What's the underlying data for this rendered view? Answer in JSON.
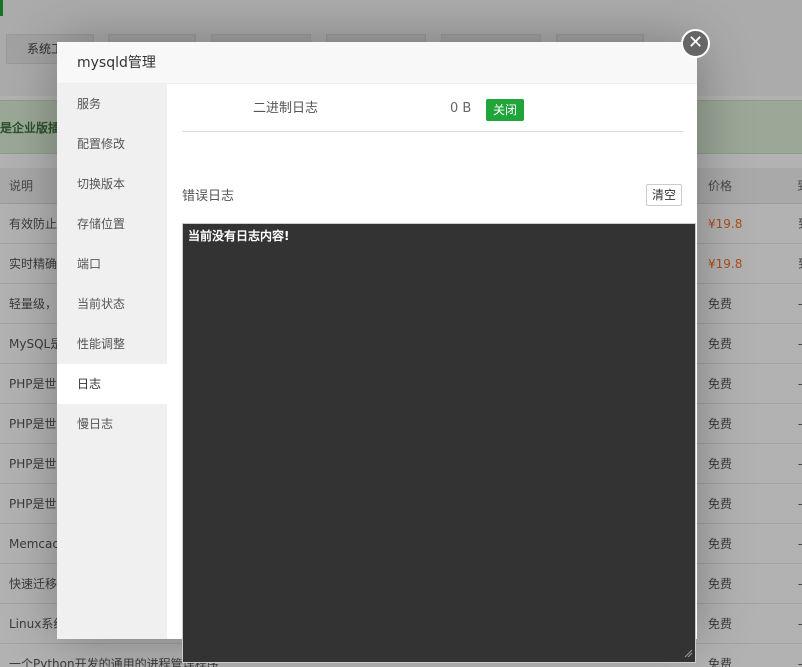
{
  "background": {
    "tabs": [
      "系统工具",
      "",
      "",
      "",
      "",
      ""
    ],
    "banner_text": "是企业版插件",
    "table": {
      "headers": {
        "description": "说明",
        "price": "价格",
        "tail": "到"
      },
      "rows": [
        {
          "description": "有效防止",
          "price": "¥19.8",
          "paid": true,
          "tail": "到"
        },
        {
          "description": "实时精确",
          "price": "¥19.8",
          "paid": true,
          "tail": "到"
        },
        {
          "description": "轻量级，",
          "price": "免费",
          "paid": false,
          "tail": "-"
        },
        {
          "description": "MySQL是",
          "price": "免费",
          "paid": false,
          "tail": "-"
        },
        {
          "description": "PHP是世",
          "price": "免费",
          "paid": false,
          "tail": "-"
        },
        {
          "description": "PHP是世",
          "price": "免费",
          "paid": false,
          "tail": "-"
        },
        {
          "description": "PHP是世",
          "price": "免费",
          "paid": false,
          "tail": "-"
        },
        {
          "description": "PHP是世",
          "price": "免费",
          "paid": false,
          "tail": "-"
        },
        {
          "description": "Memcac",
          "price": "免费",
          "paid": false,
          "tail": "-"
        },
        {
          "description": "快速迁移",
          "price": "免费",
          "paid": false,
          "tail": "-"
        },
        {
          "description": "Linux系统",
          "price": "免费",
          "paid": false,
          "tail": "-"
        },
        {
          "description": "一个Python开发的通用的进程管理程序",
          "price": "免费",
          "paid": false,
          "tail": "-"
        }
      ]
    },
    "colors": {
      "paid_price": "#fc6d26",
      "banner_bg": "#dff0d8",
      "accent": "#20a53a"
    }
  },
  "modal": {
    "title": "mysqld管理",
    "close_icon": "close-icon",
    "sidebar": {
      "items": [
        "服务",
        "配置修改",
        "切换版本",
        "存储位置",
        "端口",
        "当前状态",
        "性能调整",
        "日志",
        "慢日志"
      ],
      "active_index": 7
    },
    "binlog": {
      "label": "二进制日志",
      "size": "0 B",
      "toggle_label": "关闭"
    },
    "error_log": {
      "label": "错误日志",
      "clear_label": "清空",
      "content": "当前没有日志内容!"
    }
  }
}
